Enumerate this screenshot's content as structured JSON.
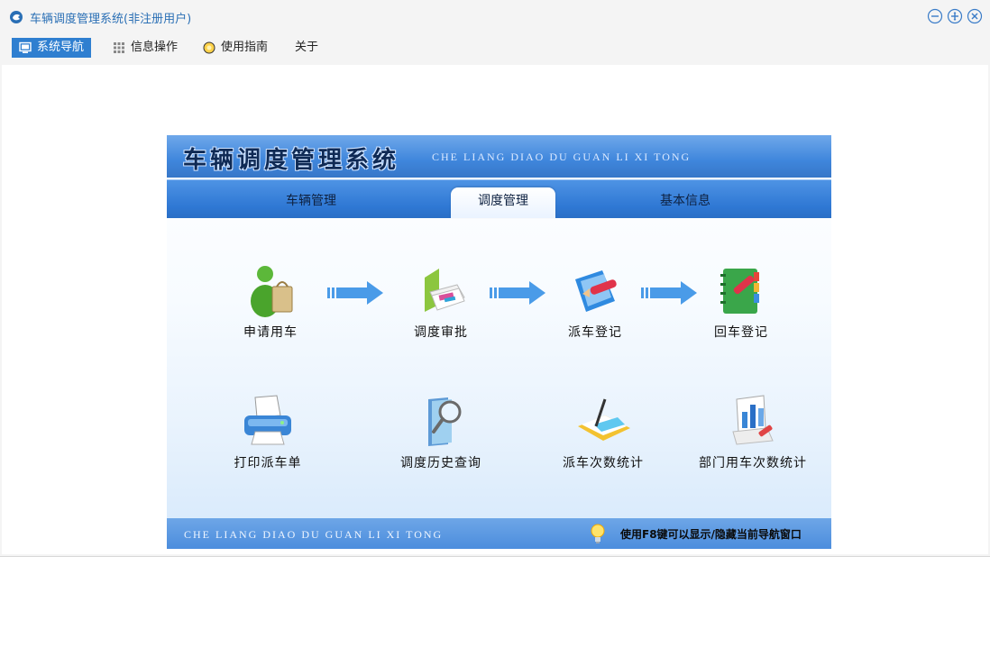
{
  "window": {
    "title": "车辆调度管理系统(非注册用户)",
    "controls": [
      "minimize-icon",
      "maximize-icon",
      "close-icon"
    ]
  },
  "menu": {
    "items": [
      {
        "label": "系统导航",
        "icon": "monitor-icon",
        "active": true
      },
      {
        "label": "信息操作",
        "icon": "grid-icon",
        "active": false
      },
      {
        "label": "使用指南",
        "icon": "help-icon",
        "active": false
      },
      {
        "label": "关于",
        "icon": "",
        "active": false
      }
    ]
  },
  "banner": {
    "title": "车辆调度管理系统",
    "pinyin": "CHE LIANG DIAO DU GUAN LI XI TONG"
  },
  "tabs": [
    {
      "label": "车辆管理",
      "active": false
    },
    {
      "label": "调度管理",
      "active": true
    },
    {
      "label": "基本信息",
      "active": false
    }
  ],
  "workflow": [
    {
      "label": "申请用车",
      "icon": "user-bag-icon"
    },
    {
      "label": "调度审批",
      "icon": "folder-stack-icon"
    },
    {
      "label": "派车登记",
      "icon": "pencil-scroll-icon"
    },
    {
      "label": "回车登记",
      "icon": "green-notebook-icon"
    }
  ],
  "tools": [
    {
      "label": "打印派车单",
      "icon": "printer-icon"
    },
    {
      "label": "调度历史查询",
      "icon": "magnifier-folder-icon"
    },
    {
      "label": "派车次数统计",
      "icon": "chart-book-icon"
    },
    {
      "label": "部门用车次数统计",
      "icon": "bar-chart-board-icon"
    }
  ],
  "footer": {
    "pinyin": "CHE LIANG DIAO DU GUAN LI XI TONG",
    "hint": "使用F8键可以显示/隐藏当前导航窗口"
  },
  "colors": {
    "accent": "#2f7fd0",
    "title_text": "#2a6fb5",
    "banner_blue": "#3f86dc",
    "arrow_blue": "#4a9be8"
  }
}
